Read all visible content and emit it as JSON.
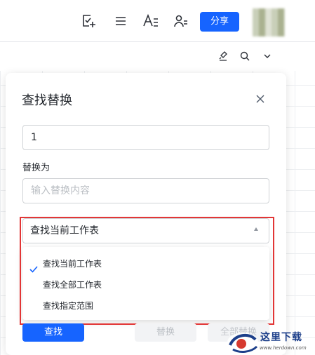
{
  "toolbar": {
    "share_label": "分享",
    "icons": [
      "task-add-icon",
      "list-icon",
      "text-format-icon",
      "user-share-icon"
    ]
  },
  "sheet_toolbar": {
    "icons": [
      "brush-icon",
      "search-icon",
      "chevron-down-icon"
    ]
  },
  "panel": {
    "title": "查找替换",
    "find_value": "1",
    "replace_label": "替换为",
    "replace_placeholder": "输入替换内容",
    "scope_selected": "查找当前工作表",
    "scope_options": [
      {
        "label": "查找当前工作表",
        "checked": true
      },
      {
        "label": "查找全部工作表",
        "checked": false
      },
      {
        "label": "查找指定范围",
        "checked": false
      }
    ],
    "find_button": "查找",
    "replace_button": "替换",
    "replace_all_button": "全部替换"
  },
  "watermark": {
    "title": "这里下载",
    "url": "www.herdown.com"
  },
  "colors": {
    "accent": "#1664ff",
    "highlight": "#e23636"
  }
}
